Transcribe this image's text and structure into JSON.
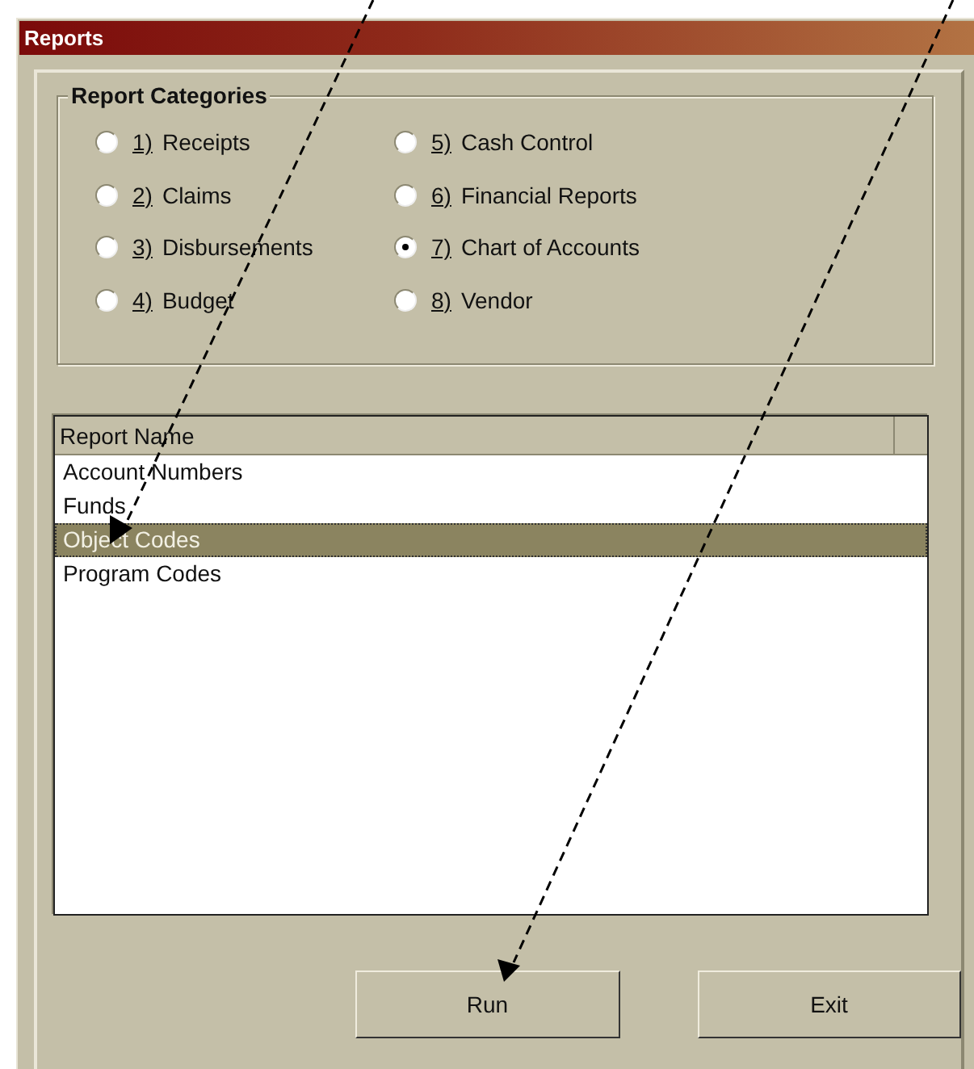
{
  "window": {
    "title": "Reports"
  },
  "report_categories": {
    "title": "Report Categories",
    "options": [
      {
        "key": "1)",
        "label": "Receipts",
        "selected": false
      },
      {
        "key": "2)",
        "label": "Claims",
        "selected": false
      },
      {
        "key": "3)",
        "label": "Disbursements",
        "selected": false
      },
      {
        "key": "4)",
        "label": "Budget",
        "selected": false
      },
      {
        "key": "5)",
        "label": "Cash Control",
        "selected": false
      },
      {
        "key": "6)",
        "label": "Financial Reports",
        "selected": false
      },
      {
        "key": "7)",
        "label": "Chart of Accounts",
        "selected": true
      },
      {
        "key": "8)",
        "label": "Vendor",
        "selected": false
      }
    ]
  },
  "report_list": {
    "columns": [
      "Report Name"
    ],
    "rows": [
      {
        "name": "Account Numbers",
        "selected": false
      },
      {
        "name": "Funds",
        "selected": false
      },
      {
        "name": "Object Codes",
        "selected": true
      },
      {
        "name": "Program Codes",
        "selected": false
      }
    ]
  },
  "buttons": [
    "Run",
    "Exit"
  ]
}
